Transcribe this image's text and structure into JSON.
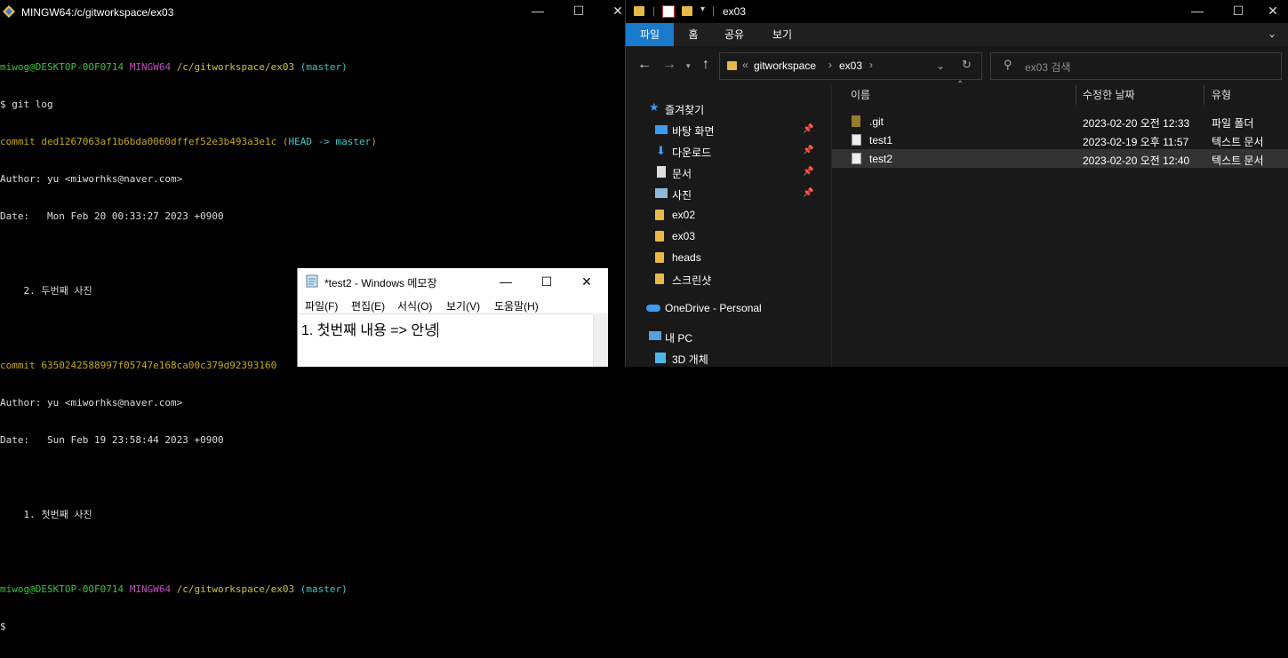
{
  "terminal": {
    "title": "MINGW64:/c/gitworkspace/ex03",
    "prompt1": {
      "user": "miwog@DESKTOP-0OF0714",
      "shell": "MINGW64",
      "path": "/c/gitworkspace/ex03",
      "branch": "(master)"
    },
    "command": "$ git log",
    "commit1": {
      "label": "commit ded1267063af1b6bda0060dffef52e3b493a3e1c",
      "ref_open": "(",
      "head": "HEAD -> master",
      "ref_close": ")",
      "author": "Author: yu <miworhks@naver.com>",
      "date": "Date:   Mon Feb 20 00:33:27 2023 +0900",
      "message": "    2. 두번째 사진"
    },
    "commit2": {
      "label": "commit 6350242588997f05747e168ca00c379d92393160",
      "author": "Author: yu <miworhks@naver.com>",
      "date": "Date:   Sun Feb 19 23:58:44 2023 +0900",
      "message": "    1. 첫번째 사진"
    },
    "prompt2": {
      "user": "miwog@DESKTOP-0OF0714",
      "shell": "MINGW64",
      "path": "/c/gitworkspace/ex03",
      "branch": "(master)"
    },
    "prompt_end": "$"
  },
  "notepad": {
    "title": "*test2 - Windows 메모장",
    "menu": [
      "파일(F)",
      "편집(E)",
      "서식(O)",
      "보기(V)",
      "도움말(H)"
    ],
    "text": "1. 첫번째 내용 => 안녕"
  },
  "explorer": {
    "title": "ex03",
    "ribbon_tabs": [
      "파일",
      "홈",
      "공유",
      "보기"
    ],
    "breadcrumbs": [
      "gitworkspace",
      "ex03"
    ],
    "search_placeholder": "ex03 검색",
    "nav": {
      "quick_access": "즐겨찾기",
      "items": [
        "바탕 화면",
        "다운로드",
        "문서",
        "사진",
        "ex02",
        "ex03",
        "heads",
        "스크린샷"
      ],
      "onedrive": "OneDrive - Personal",
      "pc": "내 PC",
      "objects3d": "3D 개체"
    },
    "columns": {
      "name": "이름",
      "modified": "수정한 날짜",
      "type": "유형"
    },
    "files": [
      {
        "name": ".git",
        "modified": "2023-02-20 오전 12:33",
        "type": "파일 폴더"
      },
      {
        "name": "test1",
        "modified": "2023-02-19 오후 11:57",
        "type": "텍스트 문서"
      },
      {
        "name": "test2",
        "modified": "2023-02-20 오전 12:40",
        "type": "텍스트 문서"
      }
    ]
  },
  "colors": {
    "accent": "#1979ca",
    "prompt_green": "#39c339",
    "prompt_magenta": "#c34fc3",
    "prompt_yellow": "#c7c43b",
    "branch_cyan": "#3fc7c7"
  }
}
